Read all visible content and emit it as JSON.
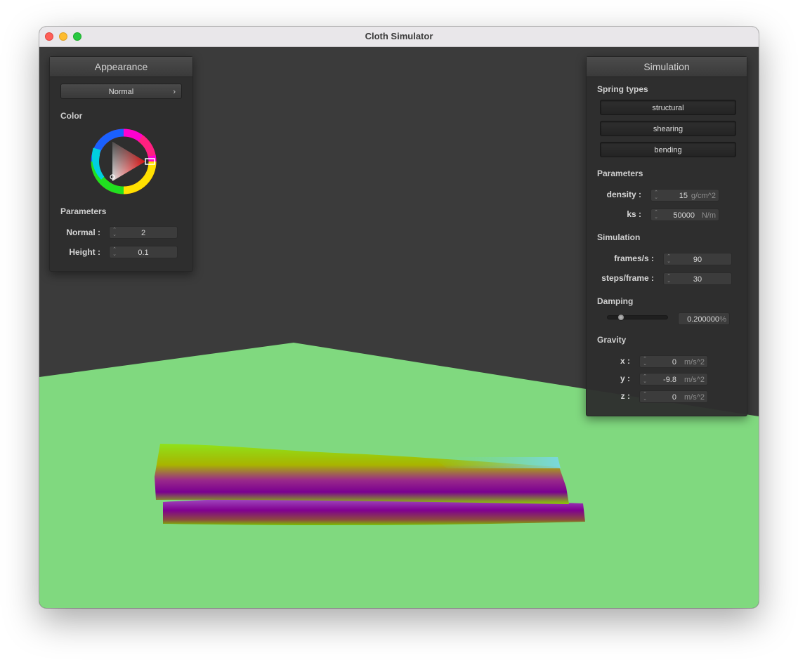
{
  "window": {
    "title": "Cloth Simulator"
  },
  "appearance": {
    "header": "Appearance",
    "shader_dropdown": "Normal",
    "color_label": "Color",
    "params_label": "Parameters",
    "normal": {
      "label": "Normal :",
      "value": "2"
    },
    "height": {
      "label": "Height :",
      "value": "0.1"
    }
  },
  "simulation": {
    "header": "Simulation",
    "spring_types_label": "Spring types",
    "springs": [
      "structural",
      "shearing",
      "bending"
    ],
    "params_label": "Parameters",
    "density": {
      "label": "density :",
      "value": "15",
      "unit": "g/cm^2"
    },
    "ks": {
      "label": "ks :",
      "value": "50000",
      "unit": "N/m"
    },
    "sim_label": "Simulation",
    "fps": {
      "label": "frames/s :",
      "value": "90"
    },
    "steps": {
      "label": "steps/frame :",
      "value": "30"
    },
    "damping_label": "Damping",
    "damping": {
      "value": "0.200000",
      "unit": "%",
      "fraction": 0.2
    },
    "gravity_label": "Gravity",
    "gx": {
      "label": "x :",
      "value": "0",
      "unit": "m/s^2"
    },
    "gy": {
      "label": "y :",
      "value": "-9.8",
      "unit": "m/s^2"
    },
    "gz": {
      "label": "z :",
      "value": "0",
      "unit": "m/s^2"
    }
  },
  "colors": {
    "floor": "#80d97f",
    "background": "#3b3b3b",
    "panel": "#2e2e2e"
  }
}
